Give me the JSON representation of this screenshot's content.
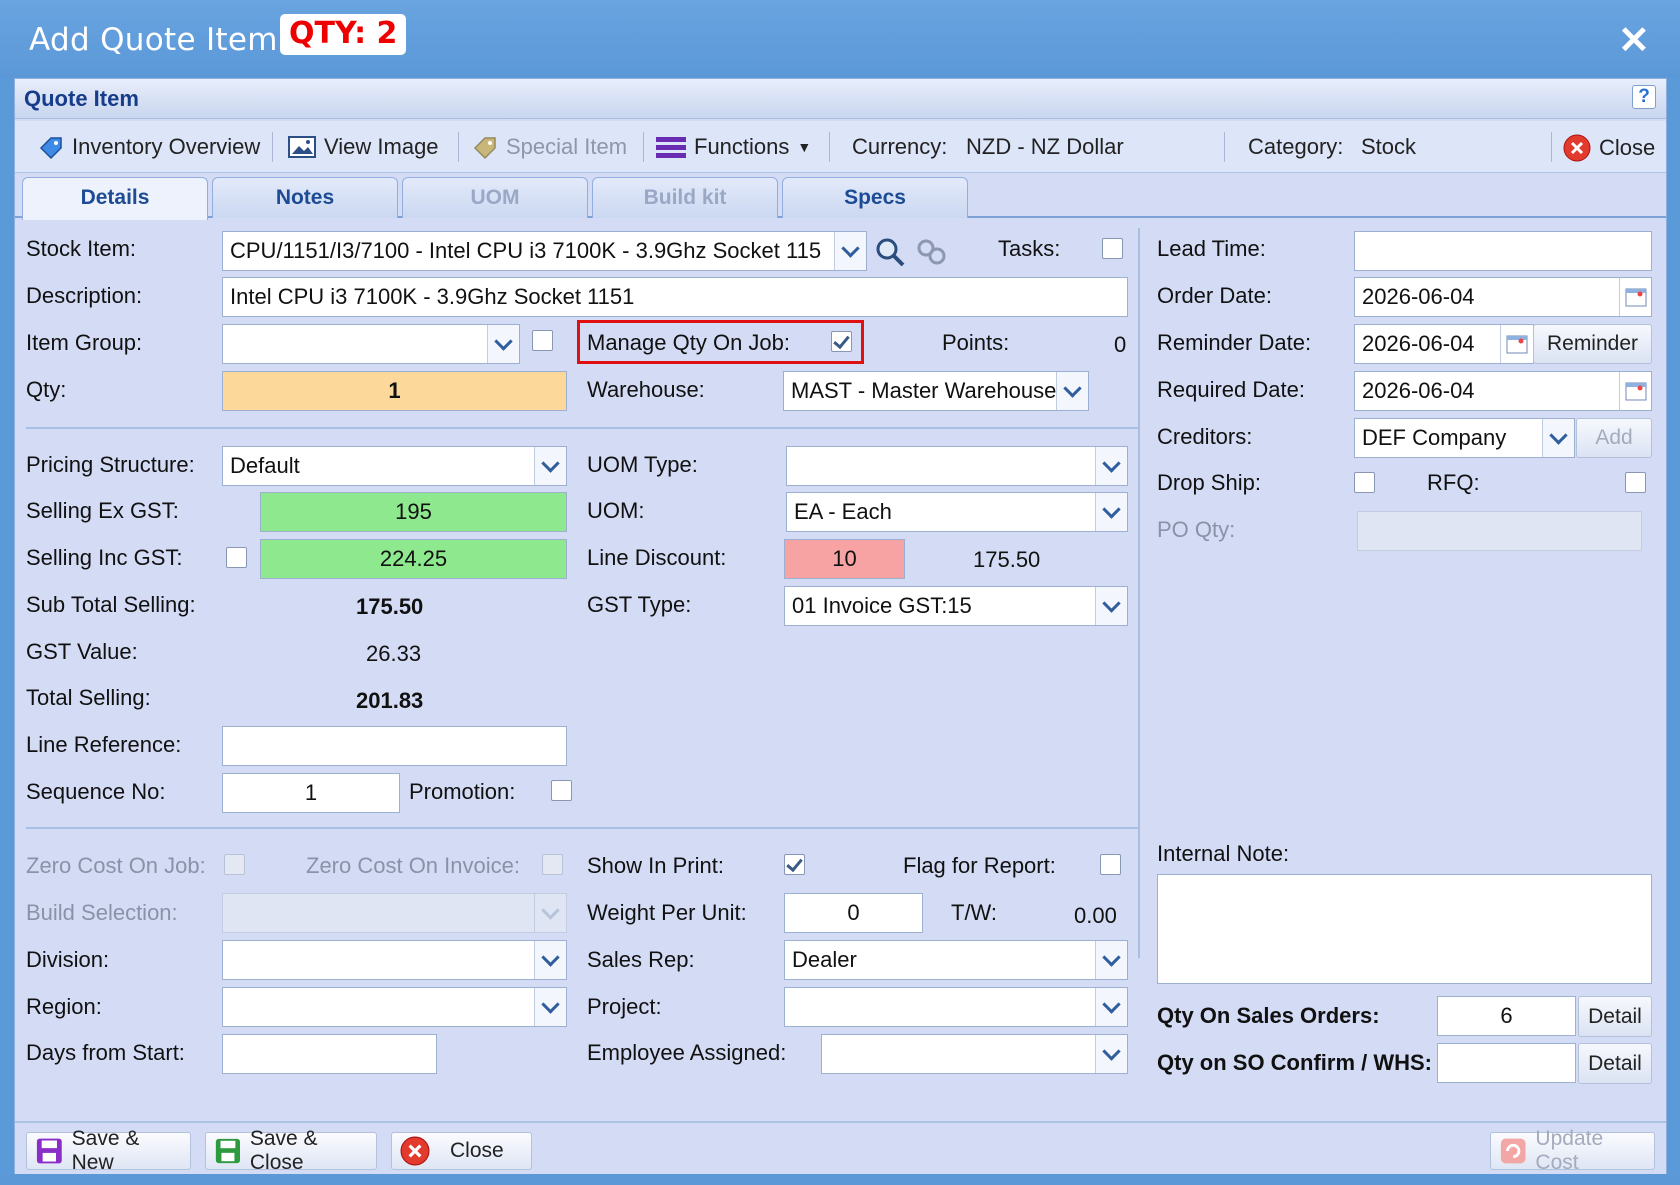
{
  "window": {
    "title": "Add Quote Item",
    "badge": "QTY: 2",
    "close_glyph": "✕"
  },
  "section": {
    "title": "Quote Item",
    "help": "?"
  },
  "toolbar": {
    "inventory_overview": "Inventory Overview",
    "view_image": "View Image",
    "special_item": "Special Item",
    "functions": "Functions",
    "currency_label": "Currency:",
    "currency_value": "NZD - NZ Dollar",
    "category_label": "Category:",
    "category_value": "Stock",
    "close": "Close"
  },
  "tabs": [
    {
      "label": "Details",
      "state": "active"
    },
    {
      "label": "Notes",
      "state": "enabled"
    },
    {
      "label": "UOM",
      "state": "disabled"
    },
    {
      "label": "Build kit",
      "state": "disabled"
    },
    {
      "label": "Specs",
      "state": "enabled"
    }
  ],
  "left": {
    "stock_item_label": "Stock Item:",
    "stock_item_value": "CPU/1151/I3/7100 - Intel CPU i3 7100K - 3.9Ghz Socket 115",
    "tasks_label": "Tasks:",
    "description_label": "Description:",
    "description_value": "Intel CPU i3 7100K - 3.9Ghz Socket 1151",
    "item_group_label": "Item Group:",
    "item_group_value": "",
    "manage_qty_label": "Manage Qty On Job:",
    "manage_qty_checked": true,
    "points_label": "Points:",
    "points_value": "0",
    "qty_label": "Qty:",
    "qty_value": "1",
    "warehouse_label": "Warehouse:",
    "warehouse_value": "MAST - Master Warehouse"
  },
  "pricing": {
    "pricing_structure_label": "Pricing Structure:",
    "pricing_structure_value": "Default",
    "selling_ex_label": "Selling Ex GST:",
    "selling_ex_value": "195",
    "selling_inc_label": "Selling Inc GST:",
    "selling_inc_value": "224.25",
    "sub_total_label": "Sub Total Selling:",
    "sub_total_value": "175.50",
    "gst_value_label": "GST Value:",
    "gst_value": "26.33",
    "total_label": "Total Selling:",
    "total_value": "201.83",
    "line_ref_label": "Line Reference:",
    "line_ref_value": "",
    "sequence_label": "Sequence No:",
    "sequence_value": "1",
    "promotion_label": "Promotion:",
    "uom_type_label": "UOM Type:",
    "uom_type_value": "",
    "uom_label": "UOM:",
    "uom_value": "EA - Each",
    "line_discount_label": "Line Discount:",
    "line_discount_value": "10",
    "line_discount_amount": "175.50",
    "gst_type_label": "GST Type:",
    "gst_type_value": "01 Invoice GST:15"
  },
  "lower": {
    "zero_cost_job_label": "Zero Cost On Job:",
    "zero_cost_invoice_label": "Zero Cost On Invoice:",
    "build_selection_label": "Build Selection:",
    "division_label": "Division:",
    "region_label": "Region:",
    "days_from_start_label": "Days from Start:",
    "show_in_print_label": "Show In Print:",
    "show_in_print_checked": true,
    "flag_report_label": "Flag for Report:",
    "weight_label": "Weight Per Unit:",
    "weight_value": "0",
    "tw_label": "T/W:",
    "tw_value": "0.00",
    "sales_rep_label": "Sales Rep:",
    "sales_rep_value": "Dealer",
    "project_label": "Project:",
    "employee_label": "Employee Assigned:"
  },
  "right": {
    "lead_time_label": "Lead Time:",
    "lead_time_value": "",
    "order_date_label": "Order Date:",
    "order_date_value": "2026-06-04",
    "reminder_date_label": "Reminder Date:",
    "reminder_date_value": "2026-06-04",
    "reminder_button": "Reminder",
    "required_date_label": "Required Date:",
    "required_date_value": "2026-06-04",
    "creditors_label": "Creditors:",
    "creditors_value": "DEF Company",
    "add_button": "Add",
    "drop_ship_label": "Drop Ship:",
    "rfq_label": "RFQ:",
    "po_qty_label": "PO Qty:",
    "internal_note_label": "Internal Note:",
    "qty_sales_orders_label": "Qty On Sales Orders:",
    "qty_sales_orders_value": "6",
    "qty_so_confirm_label": "Qty on SO Confirm / WHS:",
    "qty_so_confirm_value": "",
    "detail_button": "Detail"
  },
  "footer": {
    "save_new": "Save & New",
    "save_close": "Save & Close",
    "close": "Close",
    "update_cost": "Update Cost"
  },
  "colors": {
    "qty_bg": "#fcd99a",
    "selling_bg": "#8ee88e",
    "discount_bg": "#f8a3a3",
    "highlight_border": "#e01010",
    "title_bar": "#5b98d8"
  },
  "icons": [
    "tag-icon",
    "image-icon",
    "special-tag-icon",
    "functions-icon",
    "close-circle-icon",
    "search-icon",
    "link-icon",
    "calendar-icon",
    "save-icon",
    "update-cost-icon"
  ]
}
